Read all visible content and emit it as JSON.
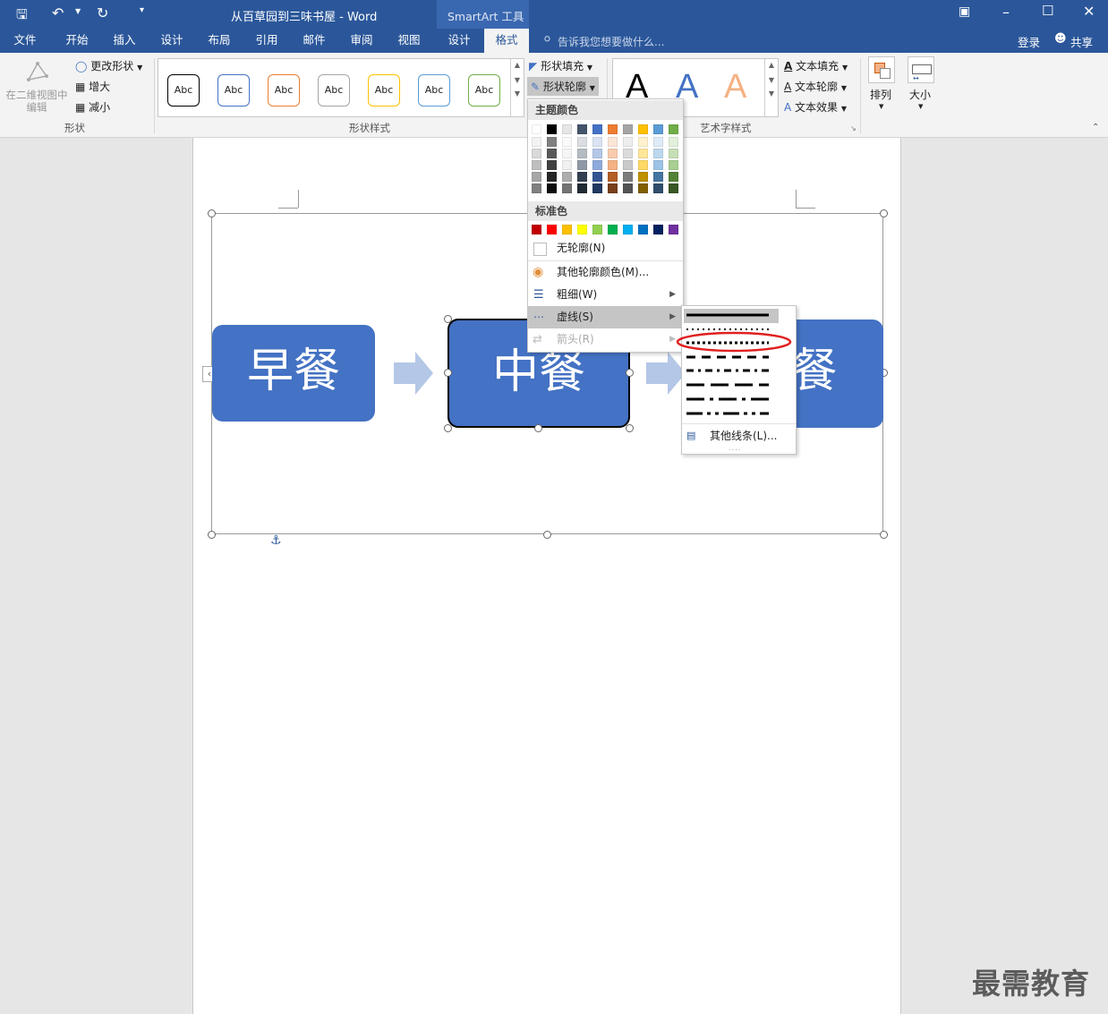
{
  "title_bar": {
    "doc_title": "从百草园到三味书屋 - Word",
    "context_tool": "SmartArt 工具"
  },
  "tabs": [
    {
      "label": "文件"
    },
    {
      "label": "开始"
    },
    {
      "label": "插入"
    },
    {
      "label": "设计"
    },
    {
      "label": "布局"
    },
    {
      "label": "引用"
    },
    {
      "label": "邮件"
    },
    {
      "label": "审阅"
    },
    {
      "label": "视图"
    },
    {
      "label": "设计"
    },
    {
      "label": "格式"
    }
  ],
  "tell_me": "告诉我您想要做什么...",
  "account": {
    "login": "登录",
    "share": "共享"
  },
  "ribbon": {
    "shapes_group": {
      "edit_2d": "在二维视图中编辑",
      "change_shape": "更改形状",
      "larger": "增大",
      "smaller": "减小",
      "label": "形状"
    },
    "styles_group": {
      "label": "形状样式",
      "presets": [
        "Abc",
        "Abc",
        "Abc",
        "Abc",
        "Abc",
        "Abc",
        "Abc"
      ],
      "fill": "形状填充",
      "outline": "形状轮廓"
    },
    "wordart_group": {
      "label": "艺术字样式",
      "letter": "A",
      "text_fill": "文本填充",
      "text_outline": "文本轮廓",
      "text_effects": "文本效果"
    },
    "arrange": "排列",
    "size": "大小"
  },
  "outline_menu": {
    "theme_header": "主题颜色",
    "standard_header": "标准色",
    "no_outline": "无轮廓(N)",
    "more_colors": "其他轮廓颜色(M)...",
    "weight": "粗细(W)",
    "dashes": "虚线(S)",
    "arrows": "箭头(R)",
    "theme_colors": [
      "#ffffff",
      "#000000",
      "#e7e6e6",
      "#44546a",
      "#4472c4",
      "#ed7d31",
      "#a5a5a5",
      "#ffc000",
      "#5b9bd5",
      "#70ad47"
    ],
    "standard_colors": [
      "#c00000",
      "#ff0000",
      "#ffc000",
      "#ffff00",
      "#92d050",
      "#00b050",
      "#00b0f0",
      "#0070c0",
      "#002060",
      "#7030a0"
    ]
  },
  "dash_menu": {
    "more_lines": "其他线条(L)..."
  },
  "smartart": {
    "box1": "早餐",
    "box2": "中餐",
    "box3": "晚餐"
  },
  "watermark": "最需教育"
}
